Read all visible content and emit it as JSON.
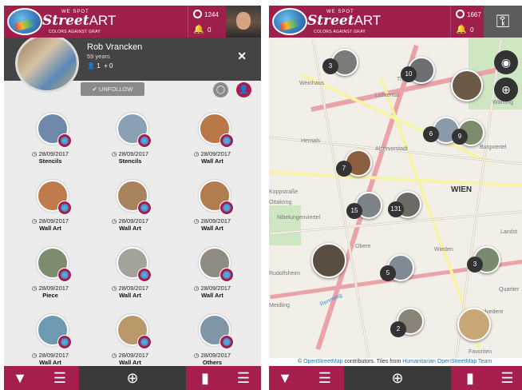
{
  "left": {
    "brand": {
      "we": "WE SPOT",
      "name_a": "Street",
      "name_b": "ART",
      "tagline": "COLORS AGAINST GRAY"
    },
    "stats": {
      "spots": "1244",
      "notifications": "0"
    },
    "profile": {
      "name": "Rob Vrancken",
      "age": "59 years",
      "followers": "1",
      "following": "0"
    },
    "unfollow_label": "UNFOLLOW",
    "close_icon": "close-icon",
    "items": [
      {
        "date": "28/09/2017",
        "category": "Stencils",
        "color": "#6f89a8"
      },
      {
        "date": "28/09/2017",
        "category": "Stencils",
        "color": "#8aa0b5"
      },
      {
        "date": "28/09/2017",
        "category": "Wall Art",
        "color": "#b8784a"
      },
      {
        "date": "28/09/2017",
        "category": "Wall Art",
        "color": "#c07b4c"
      },
      {
        "date": "28/09/2017",
        "category": "Wall Art",
        "color": "#a9835e"
      },
      {
        "date": "28/09/2017",
        "category": "Wall Art",
        "color": "#b07c50"
      },
      {
        "date": "28/09/2017",
        "category": "Piece",
        "color": "#7d8c6f"
      },
      {
        "date": "28/09/2017",
        "category": "Wall Art",
        "color": "#a3a39b"
      },
      {
        "date": "28/09/2017",
        "category": "Wall Art",
        "color": "#8f8a82"
      },
      {
        "date": "28/09/2017",
        "category": "Wall Art",
        "color": "#6d9ab1"
      },
      {
        "date": "28/09/2017",
        "category": "Wall Art",
        "color": "#b9986a"
      },
      {
        "date": "28/09/2017",
        "category": "Others",
        "color": "#8095a8"
      }
    ]
  },
  "right": {
    "brand": {
      "we": "WE SPOT",
      "name_a": "Street",
      "name_b": "ART",
      "tagline": "COLORS AGAINST GRAY"
    },
    "stats": {
      "spots": "1667",
      "notifications": "0"
    },
    "map_labels": [
      "Thury",
      "Weinhaus",
      "Hernals",
      "Alservorstadt",
      "Koppstraße",
      "Ottakring",
      "Nibelungenviertel",
      "Rudolfsheim",
      "WIEN",
      "Obere",
      "Wieden",
      "Landst",
      "Quartier",
      "Favoriten",
      "Belvedere",
      "Meidling",
      "Rennweg",
      "Burgviertel",
      "Lichtental",
      "Währing"
    ],
    "clusters": [
      "3",
      "10",
      "6",
      "9",
      "7",
      "15",
      "131",
      "5",
      "3",
      "2"
    ],
    "attribution": {
      "prefix": "© ",
      "osm": "OpenStreetMap",
      "mid": " contributors. Tiles from ",
      "hot": "Humanitarian OpenStreetMap Team"
    }
  },
  "colors": {
    "brand": "#9e1f4c",
    "bottom": "#a51e4e",
    "dark": "#3a3a3a"
  }
}
